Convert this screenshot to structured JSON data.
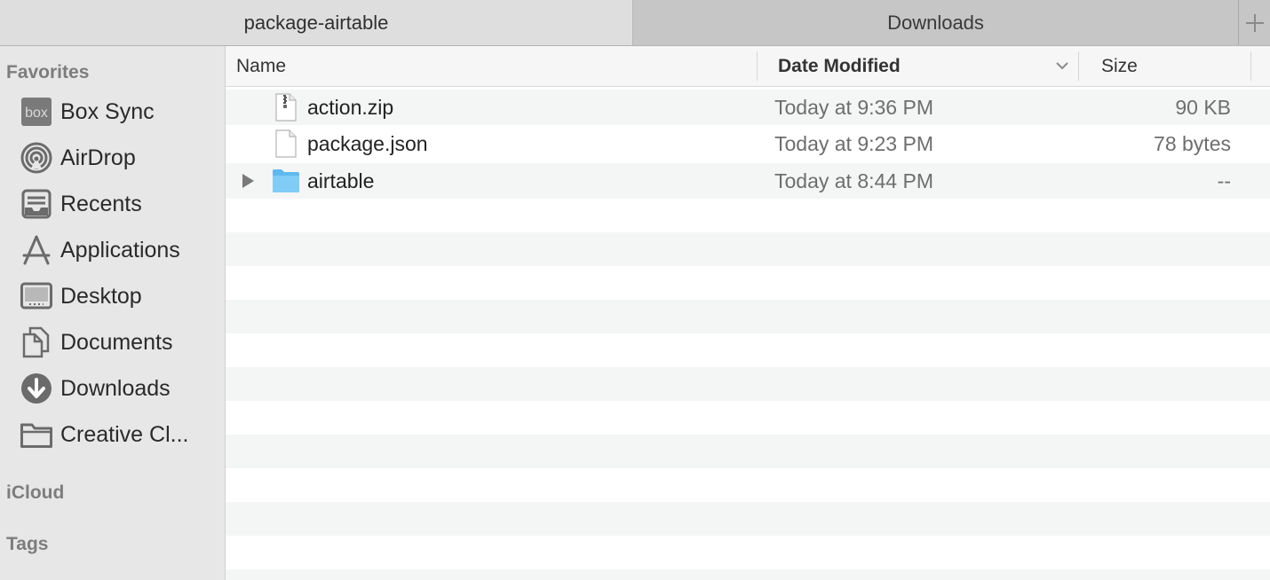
{
  "tabs": [
    {
      "label": "package-airtable",
      "active": true
    },
    {
      "label": "Downloads",
      "active": false
    }
  ],
  "new_tab_icon": "plus-icon",
  "sidebar": {
    "favorites_title": "Favorites",
    "items": [
      {
        "label": "Box Sync",
        "icon": "box-icon"
      },
      {
        "label": "AirDrop",
        "icon": "airdrop-icon"
      },
      {
        "label": "Recents",
        "icon": "recents-icon"
      },
      {
        "label": "Applications",
        "icon": "applications-icon"
      },
      {
        "label": "Desktop",
        "icon": "desktop-icon"
      },
      {
        "label": "Documents",
        "icon": "documents-icon"
      },
      {
        "label": "Downloads",
        "icon": "downloads-icon"
      },
      {
        "label": "Creative Cl...",
        "icon": "folder-icon"
      }
    ],
    "icloud_title": "iCloud",
    "tags_title": "Tags"
  },
  "columns": {
    "name": "Name",
    "date": "Date Modified",
    "size": "Size"
  },
  "files": [
    {
      "name": "action.zip",
      "date": "Today at 9:36 PM",
      "size": "90 KB",
      "icon": "zip-file-icon"
    },
    {
      "name": "package.json",
      "date": "Today at 9:23 PM",
      "size": "78 bytes",
      "icon": "document-file-icon"
    },
    {
      "name": "airtable",
      "date": "Today at 8:44 PM",
      "size": "--",
      "icon": "folder-icon",
      "expandable": true
    }
  ],
  "colors": {
    "folder_blue": "#6cc4f5",
    "sidebar_bg": "#e7e7e7",
    "stripe": "#f4f5f5"
  }
}
